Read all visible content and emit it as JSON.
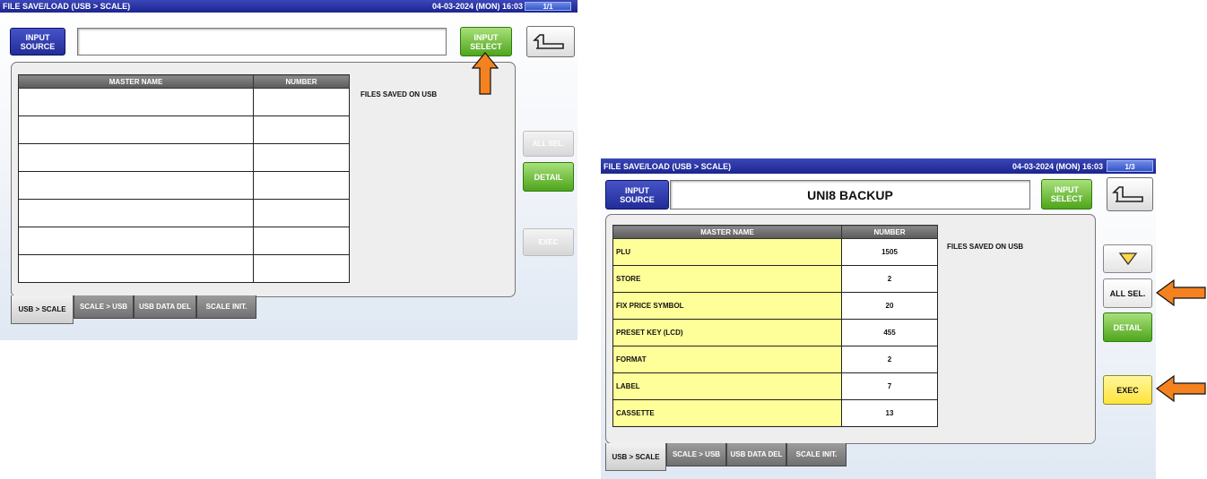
{
  "screens": {
    "left": {
      "title": "FILE SAVE/LOAD (USB > SCALE)",
      "datetime": "04-03-2024 (MON)  16:03",
      "page": "1/1",
      "input_source_label": [
        "INPUT",
        "SOURCE"
      ],
      "input_source_value": "",
      "input_select_label": [
        "INPUT",
        "SELECT"
      ],
      "table_headers": [
        "MASTER NAME",
        "NUMBER"
      ],
      "rows": [
        {
          "name": "",
          "number": ""
        },
        {
          "name": "",
          "number": ""
        },
        {
          "name": "",
          "number": ""
        },
        {
          "name": "",
          "number": ""
        },
        {
          "name": "",
          "number": ""
        },
        {
          "name": "",
          "number": ""
        },
        {
          "name": "",
          "number": ""
        }
      ],
      "files_label": "FILES SAVED ON USB",
      "buttons": {
        "all_sel": "ALL SEL.",
        "detail": "DETAIL",
        "exec": "EXEC"
      },
      "tabs": [
        "USB > SCALE",
        "SCALE > USB",
        "USB DATA DEL",
        "SCALE INIT."
      ]
    },
    "right": {
      "title": "FILE SAVE/LOAD (USB > SCALE)",
      "datetime": "04-03-2024 (MON)  16:03",
      "page": "1/3",
      "input_source_label": [
        "INPUT",
        "SOURCE"
      ],
      "input_source_value": "UNI8 BACKUP",
      "input_select_label": [
        "INPUT",
        "SELECT"
      ],
      "table_headers": [
        "MASTER NAME",
        "NUMBER"
      ],
      "rows": [
        {
          "name": "PLU",
          "number": "1505"
        },
        {
          "name": "STORE",
          "number": "2"
        },
        {
          "name": "FIX PRICE SYMBOL",
          "number": "20"
        },
        {
          "name": "PRESET KEY (LCD)",
          "number": "455"
        },
        {
          "name": "FORMAT",
          "number": "2"
        },
        {
          "name": "LABEL",
          "number": "7"
        },
        {
          "name": "CASSETTE",
          "number": "13"
        }
      ],
      "files_label": "FILES SAVED ON USB",
      "buttons": {
        "all_sel": "ALL SEL.",
        "detail": "DETAIL",
        "exec": "EXEC"
      },
      "tabs": [
        "USB > SCALE",
        "SCALE > USB",
        "USB DATA DEL",
        "SCALE INIT."
      ]
    }
  },
  "colors": {
    "titlebar": "#1b2590",
    "green_button": "#4ea51b",
    "row_highlight": "#ffff99",
    "callout_arrow": "#f58220"
  },
  "icons": {
    "back": "return-arrow-icon",
    "down": "triangle-down-icon",
    "callout": "orange-arrow-icon"
  }
}
